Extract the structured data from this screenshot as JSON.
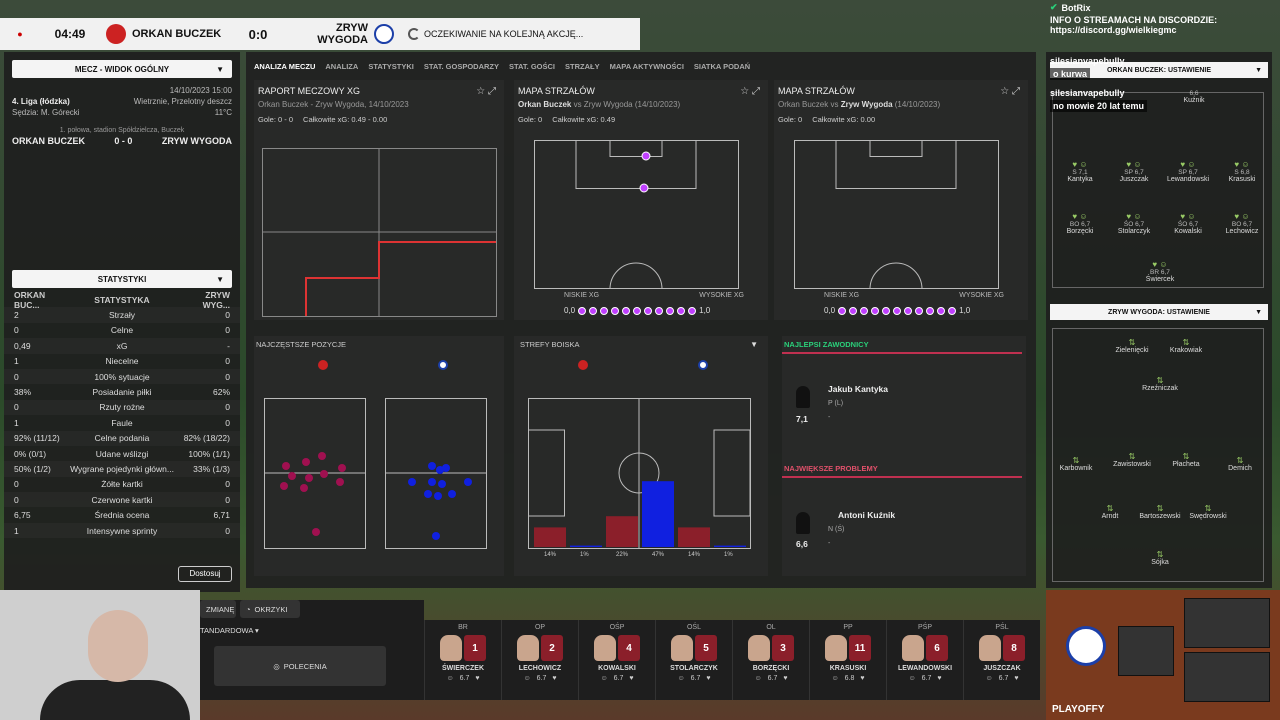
{
  "topbar": {
    "time": "04:49",
    "home": "ORKAN BUCZEK",
    "score": "0:0",
    "away": "ZRYW WYGODA",
    "status": "OCZEKIWANIE NA KOLEJNĄ AKCJĘ..."
  },
  "left": {
    "view": "MECZ - WIDOK OGÓLNY",
    "league": "4. Liga (łódzka)",
    "date": "14/10/2023 15:00",
    "referee": "Sędzia: M. Górecki",
    "weather": "Wietrznie, Przelotny deszcz",
    "temp": "11°C",
    "half": "1. połowa, stadion Spółdzielcza, Buczek",
    "home": "ORKAN BUCZEK",
    "score": "0 - 0",
    "away": "ZRYW WYGODA",
    "stats_title": "STATYSTYKI",
    "stats_head": {
      "l": "ORKAN BUC...",
      "c": "STATYSTYKA",
      "r": "ZRYW WYG..."
    },
    "stats": [
      {
        "l": "2",
        "c": "Strzały",
        "r": "0"
      },
      {
        "l": "0",
        "c": "Celne",
        "r": "0"
      },
      {
        "l": "0,49",
        "c": "xG",
        "r": "-"
      },
      {
        "l": "1",
        "c": "Niecelne",
        "r": "0"
      },
      {
        "l": "0",
        "c": "100% sytuacje",
        "r": "0"
      },
      {
        "l": "38%",
        "c": "Posiadanie piłki",
        "r": "62%"
      },
      {
        "l": "0",
        "c": "Rzuty rożne",
        "r": "0"
      },
      {
        "l": "1",
        "c": "Faule",
        "r": "0"
      },
      {
        "l": "92% (11/12)",
        "c": "Celne podania",
        "r": "82% (18/22)"
      },
      {
        "l": "0% (0/1)",
        "c": "Udane wślizgi",
        "r": "100% (1/1)"
      },
      {
        "l": "50% (1/2)",
        "c": "Wygrane pojedynki główn...",
        "r": "33% (1/3)"
      },
      {
        "l": "0",
        "c": "Żółte kartki",
        "r": "0"
      },
      {
        "l": "0",
        "c": "Czerwone kartki",
        "r": "0"
      },
      {
        "l": "6,75",
        "c": "Średnia ocena",
        "r": "6,71"
      },
      {
        "l": "1",
        "c": "Intensywne sprinty",
        "r": "0"
      }
    ],
    "button": "Dostosuj"
  },
  "tabs": [
    "ANALIZA MECZU",
    "ANALIZA",
    "STATYSTYKI",
    "STAT. GOSPODARZY",
    "STAT. GOŚCI",
    "STRZAŁY",
    "MAPA AKTYWNOŚCI",
    "SIATKA PODAŃ"
  ],
  "cards": {
    "xg": {
      "title": "RAPORT MECZOWY XG",
      "sub": "Orkan Buczek - Zryw Wygoda, 14/10/2023",
      "goals": "Gole: 0 - 0",
      "xg": "Całkowite xG: 0.49 - 0.00"
    },
    "shots_home": {
      "title": "MAPA STRZAŁÓW",
      "team": "Orkan Buczek",
      "vs": " vs Zryw Wygoda (14/10/2023)",
      "goals": "Gole: 0",
      "xg": "Całkowite xG: 0.49"
    },
    "shots_away": {
      "title": "MAPA STRZAŁÓW",
      "pre": "Orkan Buczek vs ",
      "team": "Zryw Wygoda",
      "date": " (14/10/2023)",
      "goals": "Gole: 0",
      "xg": "Całkowite xG: 0.00"
    },
    "xg_scale": {
      "low": "NISKIE XG",
      "high": "WYSOKIE XG",
      "min": "0,0",
      "max": "1,0"
    },
    "positions": "NAJCZĘSTSZE POZYCJE",
    "zones": {
      "title": "STREFY BOISKA",
      "labels": [
        "14%",
        "1%",
        "22%",
        "47%",
        "14%",
        "1%"
      ]
    },
    "best": {
      "title": "NAJLEPSI ZAWODNICY",
      "name": "Jakub Kantyka",
      "pos": "P (L)",
      "rating": "7,1",
      "extra": "-"
    },
    "worst": {
      "title": "NAJWIĘKSZE PROBLEMY",
      "name": "Antoni Kuźnik",
      "pos": "N (Ś)",
      "rating": "6,6",
      "extra": "-"
    }
  },
  "right": {
    "home_title": "ORKAN BUCZEK: USTAWIENIE",
    "away_title": "ZRYW WYGODA: USTAWIENIE",
    "home_players": [
      {
        "pos": "S",
        "r": "7,1",
        "n": "Kantyka"
      },
      {
        "pos": "SP",
        "r": "6,7",
        "n": "Juszczak"
      },
      {
        "pos": "SP",
        "r": "6,7",
        "n": "Lewandowski"
      },
      {
        "pos": "S",
        "r": "6,8",
        "n": "Krasuski"
      },
      {
        "pos": "BO",
        "r": "6,7",
        "n": "Borzęcki"
      },
      {
        "pos": "ŚO",
        "r": "6,7",
        "n": "Stolarczyk"
      },
      {
        "pos": "ŚO",
        "r": "6,7",
        "n": "Kowalski"
      },
      {
        "pos": "BO",
        "r": "6,7",
        "n": "Lechowicz"
      },
      {
        "pos": "BR",
        "r": "6,7",
        "n": "Świercek"
      }
    ],
    "home_top": {
      "n": "Kuźnik",
      "r": "6,6"
    },
    "away_players": [
      "Zielenięcki",
      "Krakowiak",
      "Rzeźniczak",
      "Karbownik",
      "Zawistowski",
      "Płacheta",
      "Demich",
      "Arndt",
      "Bartoszewski",
      "Swędrowski",
      "Sójka"
    ]
  },
  "chat": {
    "bot": "BotRix",
    "info": "INFO O STREAMACH NA DISCORDZIE:",
    "link": "https://discord.gg/wielkiegmc",
    "user1": "silesianvapebully",
    "msg1": "o kurwa",
    "user2": "silesianvapebully",
    "msg2": "no mowie 20 lat temu"
  },
  "bottom": {
    "change": "ZMIANĘ",
    "instr": "OKRZYKI",
    "tactic": "TANDARDOWA",
    "orders": "POLECENIA",
    "players": [
      {
        "pos": "BR",
        "num": "1",
        "name": "ŚWIERCZEK",
        "r": "6.7"
      },
      {
        "pos": "OP",
        "num": "2",
        "name": "LECHOWICZ",
        "r": "6.7"
      },
      {
        "pos": "OŚP",
        "num": "4",
        "name": "KOWALSKI",
        "r": "6.7"
      },
      {
        "pos": "OŚL",
        "num": "5",
        "name": "STOLARCZYK",
        "r": "6.7"
      },
      {
        "pos": "OL",
        "num": "3",
        "name": "BORZĘCKI",
        "r": "6.7"
      },
      {
        "pos": "PP",
        "num": "11",
        "name": "KRASUSKI",
        "r": "6.8"
      },
      {
        "pos": "PŚP",
        "num": "6",
        "name": "LEWANDOWSKI",
        "r": "6.7"
      },
      {
        "pos": "PŚL",
        "num": "8",
        "name": "JUSZCZAK",
        "r": "6.7"
      }
    ]
  },
  "brand": "PLAYOFFY"
}
